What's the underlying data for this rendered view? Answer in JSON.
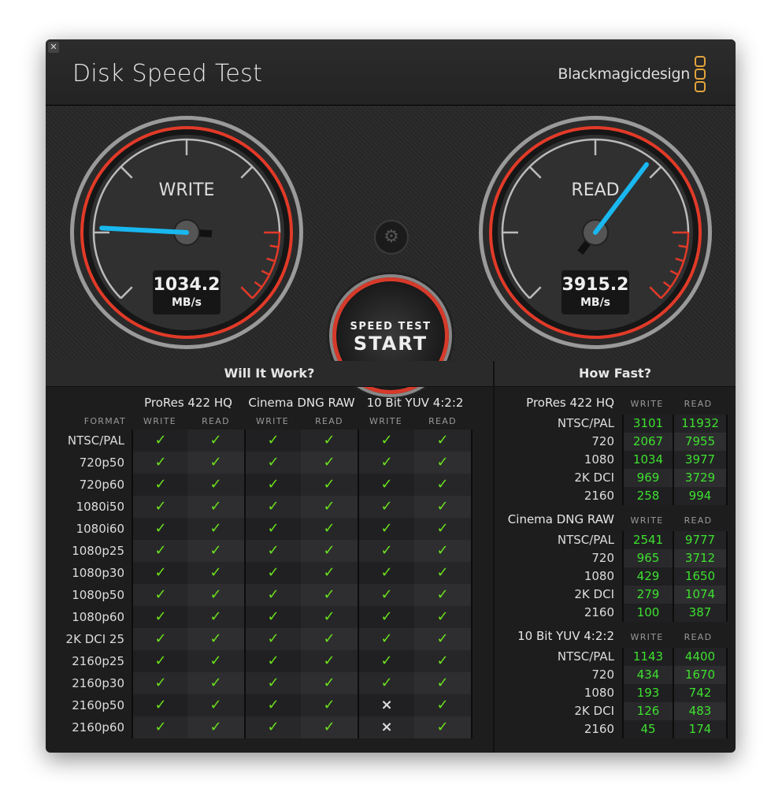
{
  "window": {
    "title": "Disk Speed Test",
    "brand": "Blackmagicdesign",
    "close_icon": "close-icon"
  },
  "gauges": {
    "write": {
      "label": "WRITE",
      "value": "1034.2",
      "unit": "MB/s"
    },
    "read": {
      "label": "READ",
      "value": "3915.2",
      "unit": "MB/s"
    }
  },
  "start_button": {
    "line1": "SPEED TEST",
    "line2": "START"
  },
  "settings_icon": "gear-icon",
  "colors": {
    "accent_red": "#e23a28",
    "needle": "#19b8f0",
    "ok": "#6be01e",
    "value": "#3ee02f",
    "brand": "#e3a43a"
  },
  "will_it_work": {
    "title": "Will It Work?",
    "format_header": "FORMAT",
    "groups": [
      "ProRes 422 HQ",
      "Cinema DNG RAW",
      "10 Bit YUV 4:2:2"
    ],
    "subcols": [
      "WRITE",
      "READ",
      "WRITE",
      "READ",
      "WRITE",
      "READ"
    ],
    "rows": [
      {
        "format": "NTSC/PAL",
        "results": [
          true,
          true,
          true,
          true,
          true,
          true
        ]
      },
      {
        "format": "720p50",
        "results": [
          true,
          true,
          true,
          true,
          true,
          true
        ]
      },
      {
        "format": "720p60",
        "results": [
          true,
          true,
          true,
          true,
          true,
          true
        ]
      },
      {
        "format": "1080i50",
        "results": [
          true,
          true,
          true,
          true,
          true,
          true
        ]
      },
      {
        "format": "1080i60",
        "results": [
          true,
          true,
          true,
          true,
          true,
          true
        ]
      },
      {
        "format": "1080p25",
        "results": [
          true,
          true,
          true,
          true,
          true,
          true
        ]
      },
      {
        "format": "1080p30",
        "results": [
          true,
          true,
          true,
          true,
          true,
          true
        ]
      },
      {
        "format": "1080p50",
        "results": [
          true,
          true,
          true,
          true,
          true,
          true
        ]
      },
      {
        "format": "1080p60",
        "results": [
          true,
          true,
          true,
          true,
          true,
          true
        ]
      },
      {
        "format": "2K DCI 25",
        "results": [
          true,
          true,
          true,
          true,
          true,
          true
        ]
      },
      {
        "format": "2160p25",
        "results": [
          true,
          true,
          true,
          true,
          true,
          true
        ]
      },
      {
        "format": "2160p30",
        "results": [
          true,
          true,
          true,
          true,
          true,
          true
        ]
      },
      {
        "format": "2160p50",
        "results": [
          true,
          true,
          true,
          true,
          false,
          true
        ]
      },
      {
        "format": "2160p60",
        "results": [
          true,
          true,
          true,
          true,
          false,
          true
        ]
      }
    ],
    "check": "✓",
    "cross": "×"
  },
  "how_fast": {
    "title": "How Fast?",
    "write_header": "WRITE",
    "read_header": "READ",
    "groups": [
      {
        "name": "ProRes 422 HQ",
        "rows": [
          {
            "res": "NTSC/PAL",
            "write": "3101",
            "read": "11932"
          },
          {
            "res": "720",
            "write": "2067",
            "read": "7955"
          },
          {
            "res": "1080",
            "write": "1034",
            "read": "3977"
          },
          {
            "res": "2K DCI",
            "write": "969",
            "read": "3729"
          },
          {
            "res": "2160",
            "write": "258",
            "read": "994"
          }
        ]
      },
      {
        "name": "Cinema DNG RAW",
        "rows": [
          {
            "res": "NTSC/PAL",
            "write": "2541",
            "read": "9777"
          },
          {
            "res": "720",
            "write": "965",
            "read": "3712"
          },
          {
            "res": "1080",
            "write": "429",
            "read": "1650"
          },
          {
            "res": "2K DCI",
            "write": "279",
            "read": "1074"
          },
          {
            "res": "2160",
            "write": "100",
            "read": "387"
          }
        ]
      },
      {
        "name": "10 Bit YUV 4:2:2",
        "rows": [
          {
            "res": "NTSC/PAL",
            "write": "1143",
            "read": "4400"
          },
          {
            "res": "720",
            "write": "434",
            "read": "1670"
          },
          {
            "res": "1080",
            "write": "193",
            "read": "742"
          },
          {
            "res": "2K DCI",
            "write": "126",
            "read": "483"
          },
          {
            "res": "2160",
            "write": "45",
            "read": "174"
          }
        ]
      }
    ]
  }
}
